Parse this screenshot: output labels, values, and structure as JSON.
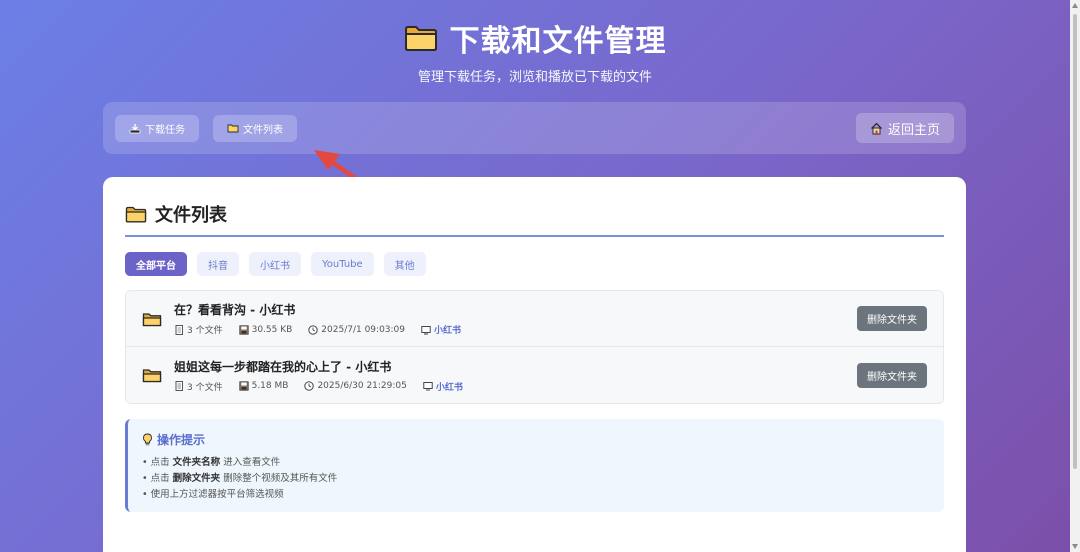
{
  "header": {
    "title": "下载和文件管理",
    "subtitle": "管理下载任务，浏览和播放已下载的文件",
    "icon": "folder-icon"
  },
  "toolbar": {
    "tasks_label": "下载任务",
    "files_label": "文件列表",
    "home_label": "返回主页"
  },
  "panel": {
    "title": "文件列表",
    "accent": "#7b8fe0"
  },
  "filters": [
    {
      "label": "全部平台",
      "active": true
    },
    {
      "label": "抖音",
      "active": false
    },
    {
      "label": "小红书",
      "active": false
    },
    {
      "label": "YouTube",
      "active": false
    },
    {
      "label": "其他",
      "active": false
    }
  ],
  "folders": [
    {
      "name": "在？看看背沟 - 小红书",
      "file_count": "3 个文件",
      "size": "30.55 KB",
      "date": "2025/7/1 09:03:09",
      "platform": "小红书",
      "delete_label": "删除文件夹"
    },
    {
      "name": "姐姐这每一步都踏在我的心上了 - 小红书",
      "file_count": "3 个文件",
      "size": "5.18 MB",
      "date": "2025/6/30 21:29:05",
      "platform": "小红书",
      "delete_label": "删除文件夹"
    }
  ],
  "tips": {
    "title": "操作提示",
    "lines": [
      {
        "pre": "点击 ",
        "bold": "文件夹名称",
        "post": " 进入查看文件"
      },
      {
        "pre": "点击 ",
        "bold": "删除文件夹",
        "post": " 删除整个视频及其所有文件"
      },
      {
        "pre": "使用上方过滤器按平台筛选视频",
        "bold": "",
        "post": ""
      }
    ]
  },
  "colors": {
    "gradient_start": "#6b7fe6",
    "gradient_end": "#7b4fa9",
    "active_chip": "#6b63c7",
    "delete_button": "#6c757d",
    "arrow": "#e5483f"
  }
}
